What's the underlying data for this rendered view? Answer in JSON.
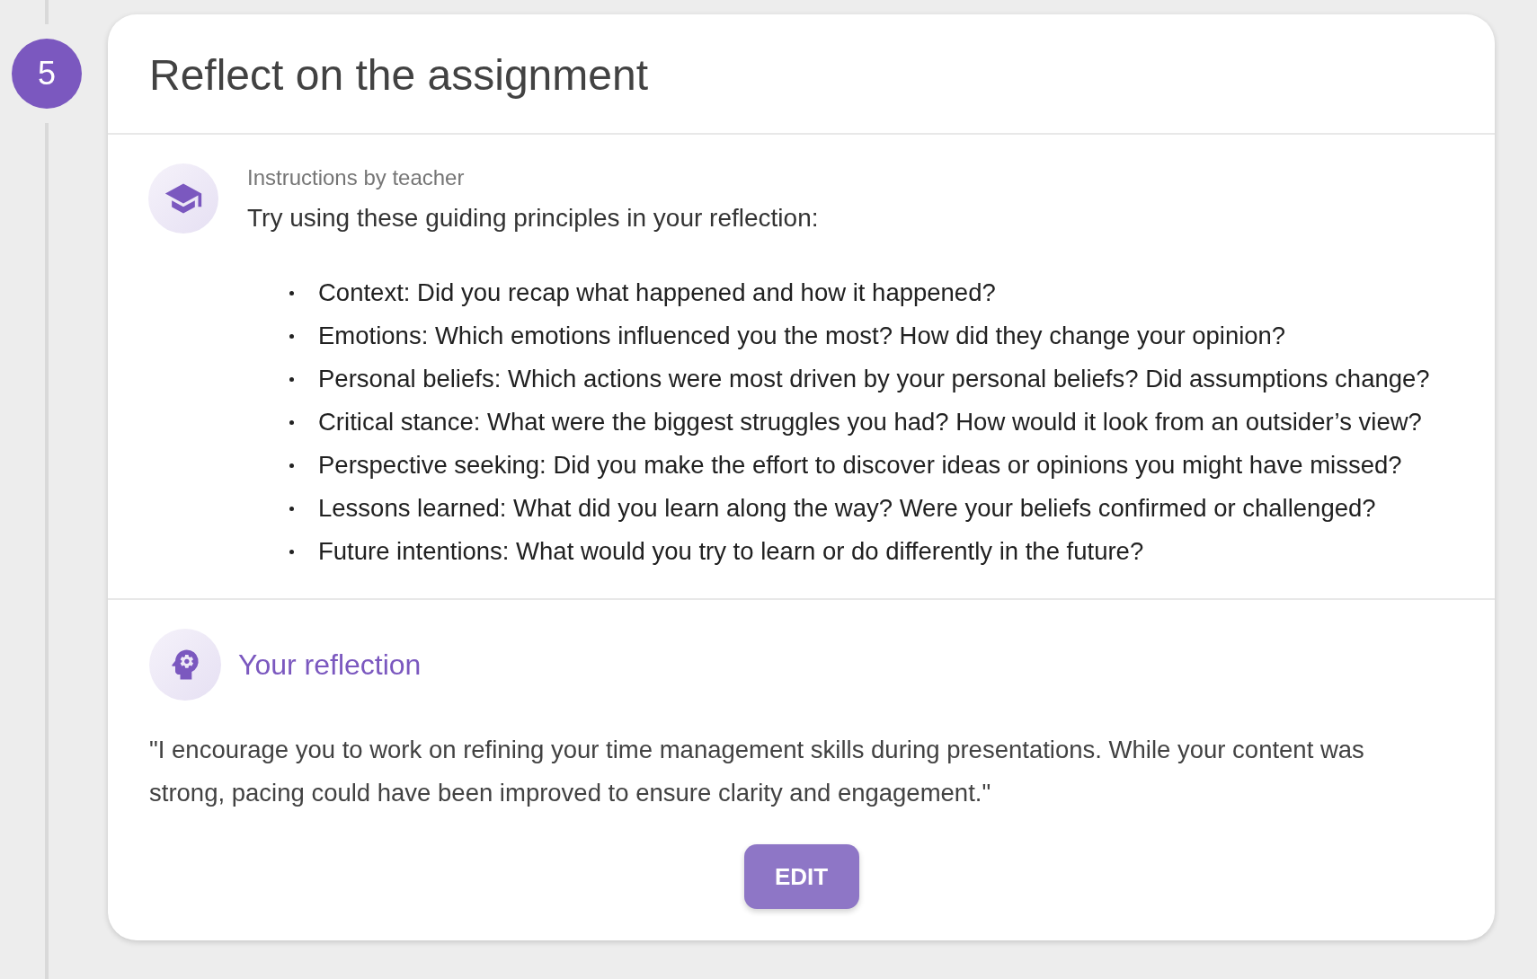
{
  "step": {
    "number": "5"
  },
  "card": {
    "title": "Reflect on the assignment"
  },
  "instructions": {
    "label": "Instructions by teacher",
    "intro": "Try using these guiding principles in your reflection:",
    "items": [
      "Context: Did you recap what happened and how it happened?",
      "Emotions: Which emotions influenced you the most? How did they change your opinion?",
      "Personal beliefs: Which actions were most driven by your personal beliefs? Did assumptions change?",
      "Critical stance: What were the biggest struggles you had? How would it look from an outsider’s view?",
      "Perspective seeking: Did you make the effort to discover ideas or opinions you might have missed?",
      "Lessons learned: What did you learn along the way? Were your beliefs confirmed or challenged?",
      "Future intentions: What would you try to learn or do differently in the future?"
    ]
  },
  "reflection": {
    "heading": "Your reflection",
    "text": "\"I encourage you to work on refining your time management skills during presentations. While your content was strong, pacing could have been improved to ensure clarity and engagement.\"",
    "button": "EDIT"
  }
}
